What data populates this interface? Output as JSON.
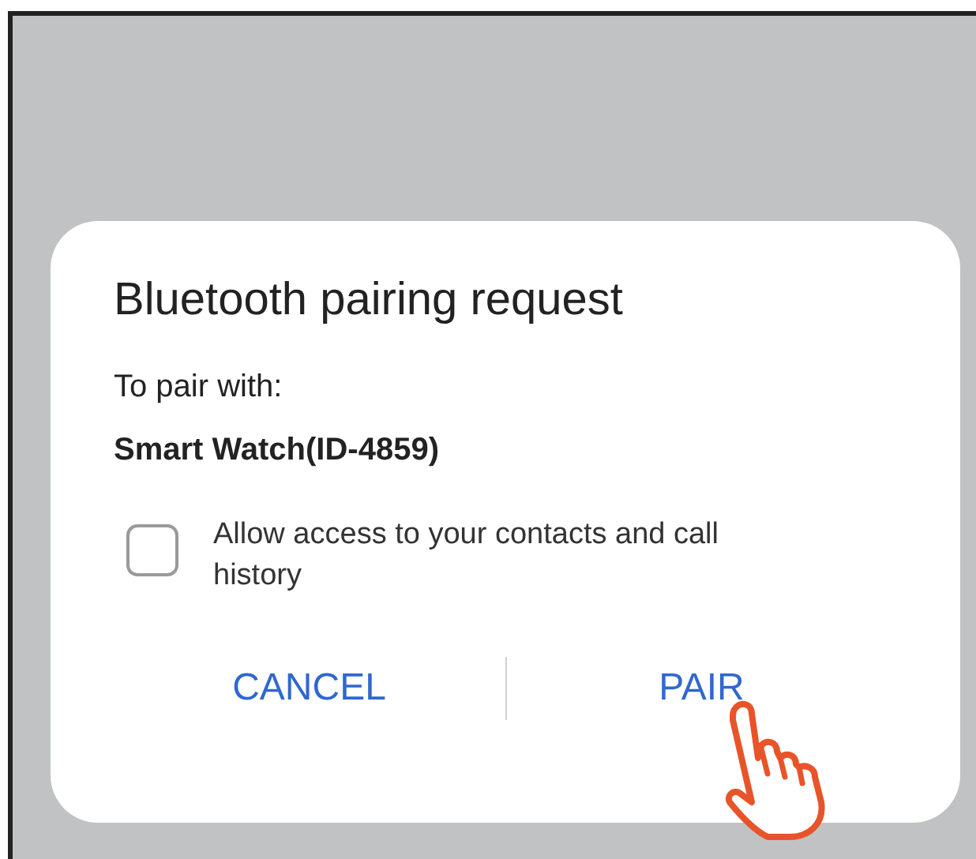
{
  "dialog": {
    "title": "Bluetooth pairing request",
    "prompt": "To pair with:",
    "device": "Smart Watch(ID-4859)",
    "checkbox": {
      "label": "Allow access to your contacts and call history",
      "checked": false
    },
    "buttons": [
      {
        "label": "CANCEL"
      },
      {
        "label": "PAIR"
      }
    ]
  }
}
